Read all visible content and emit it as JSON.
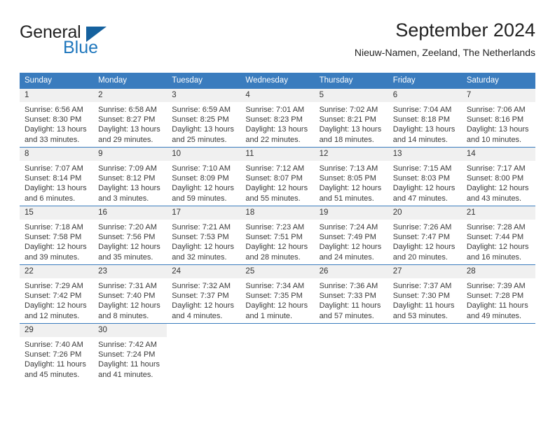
{
  "brand": {
    "name_part1": "General",
    "name_part2": "Blue",
    "triangle_color": "#15619e",
    "blue_color": "#1f77bd"
  },
  "header": {
    "title": "September 2024",
    "subtitle": "Nieuw-Namen, Zeeland, The Netherlands"
  },
  "theme": {
    "header_row_bg": "#3a7cbe",
    "daynum_bg": "#f0f0f0",
    "text": "#3a3a3a"
  },
  "weekday_headers": [
    "Sunday",
    "Monday",
    "Tuesday",
    "Wednesday",
    "Thursday",
    "Friday",
    "Saturday"
  ],
  "weeks": [
    {
      "days": [
        {
          "num": "1",
          "sunrise": "Sunrise: 6:56 AM",
          "sunset": "Sunset: 8:30 PM",
          "daylight1": "Daylight: 13 hours",
          "daylight2": "and 33 minutes."
        },
        {
          "num": "2",
          "sunrise": "Sunrise: 6:58 AM",
          "sunset": "Sunset: 8:27 PM",
          "daylight1": "Daylight: 13 hours",
          "daylight2": "and 29 minutes."
        },
        {
          "num": "3",
          "sunrise": "Sunrise: 6:59 AM",
          "sunset": "Sunset: 8:25 PM",
          "daylight1": "Daylight: 13 hours",
          "daylight2": "and 25 minutes."
        },
        {
          "num": "4",
          "sunrise": "Sunrise: 7:01 AM",
          "sunset": "Sunset: 8:23 PM",
          "daylight1": "Daylight: 13 hours",
          "daylight2": "and 22 minutes."
        },
        {
          "num": "5",
          "sunrise": "Sunrise: 7:02 AM",
          "sunset": "Sunset: 8:21 PM",
          "daylight1": "Daylight: 13 hours",
          "daylight2": "and 18 minutes."
        },
        {
          "num": "6",
          "sunrise": "Sunrise: 7:04 AM",
          "sunset": "Sunset: 8:18 PM",
          "daylight1": "Daylight: 13 hours",
          "daylight2": "and 14 minutes."
        },
        {
          "num": "7",
          "sunrise": "Sunrise: 7:06 AM",
          "sunset": "Sunset: 8:16 PM",
          "daylight1": "Daylight: 13 hours",
          "daylight2": "and 10 minutes."
        }
      ]
    },
    {
      "days": [
        {
          "num": "8",
          "sunrise": "Sunrise: 7:07 AM",
          "sunset": "Sunset: 8:14 PM",
          "daylight1": "Daylight: 13 hours",
          "daylight2": "and 6 minutes."
        },
        {
          "num": "9",
          "sunrise": "Sunrise: 7:09 AM",
          "sunset": "Sunset: 8:12 PM",
          "daylight1": "Daylight: 13 hours",
          "daylight2": "and 3 minutes."
        },
        {
          "num": "10",
          "sunrise": "Sunrise: 7:10 AM",
          "sunset": "Sunset: 8:09 PM",
          "daylight1": "Daylight: 12 hours",
          "daylight2": "and 59 minutes."
        },
        {
          "num": "11",
          "sunrise": "Sunrise: 7:12 AM",
          "sunset": "Sunset: 8:07 PM",
          "daylight1": "Daylight: 12 hours",
          "daylight2": "and 55 minutes."
        },
        {
          "num": "12",
          "sunrise": "Sunrise: 7:13 AM",
          "sunset": "Sunset: 8:05 PM",
          "daylight1": "Daylight: 12 hours",
          "daylight2": "and 51 minutes."
        },
        {
          "num": "13",
          "sunrise": "Sunrise: 7:15 AM",
          "sunset": "Sunset: 8:03 PM",
          "daylight1": "Daylight: 12 hours",
          "daylight2": "and 47 minutes."
        },
        {
          "num": "14",
          "sunrise": "Sunrise: 7:17 AM",
          "sunset": "Sunset: 8:00 PM",
          "daylight1": "Daylight: 12 hours",
          "daylight2": "and 43 minutes."
        }
      ]
    },
    {
      "days": [
        {
          "num": "15",
          "sunrise": "Sunrise: 7:18 AM",
          "sunset": "Sunset: 7:58 PM",
          "daylight1": "Daylight: 12 hours",
          "daylight2": "and 39 minutes."
        },
        {
          "num": "16",
          "sunrise": "Sunrise: 7:20 AM",
          "sunset": "Sunset: 7:56 PM",
          "daylight1": "Daylight: 12 hours",
          "daylight2": "and 35 minutes."
        },
        {
          "num": "17",
          "sunrise": "Sunrise: 7:21 AM",
          "sunset": "Sunset: 7:53 PM",
          "daylight1": "Daylight: 12 hours",
          "daylight2": "and 32 minutes."
        },
        {
          "num": "18",
          "sunrise": "Sunrise: 7:23 AM",
          "sunset": "Sunset: 7:51 PM",
          "daylight1": "Daylight: 12 hours",
          "daylight2": "and 28 minutes."
        },
        {
          "num": "19",
          "sunrise": "Sunrise: 7:24 AM",
          "sunset": "Sunset: 7:49 PM",
          "daylight1": "Daylight: 12 hours",
          "daylight2": "and 24 minutes."
        },
        {
          "num": "20",
          "sunrise": "Sunrise: 7:26 AM",
          "sunset": "Sunset: 7:47 PM",
          "daylight1": "Daylight: 12 hours",
          "daylight2": "and 20 minutes."
        },
        {
          "num": "21",
          "sunrise": "Sunrise: 7:28 AM",
          "sunset": "Sunset: 7:44 PM",
          "daylight1": "Daylight: 12 hours",
          "daylight2": "and 16 minutes."
        }
      ]
    },
    {
      "days": [
        {
          "num": "22",
          "sunrise": "Sunrise: 7:29 AM",
          "sunset": "Sunset: 7:42 PM",
          "daylight1": "Daylight: 12 hours",
          "daylight2": "and 12 minutes."
        },
        {
          "num": "23",
          "sunrise": "Sunrise: 7:31 AM",
          "sunset": "Sunset: 7:40 PM",
          "daylight1": "Daylight: 12 hours",
          "daylight2": "and 8 minutes."
        },
        {
          "num": "24",
          "sunrise": "Sunrise: 7:32 AM",
          "sunset": "Sunset: 7:37 PM",
          "daylight1": "Daylight: 12 hours",
          "daylight2": "and 4 minutes."
        },
        {
          "num": "25",
          "sunrise": "Sunrise: 7:34 AM",
          "sunset": "Sunset: 7:35 PM",
          "daylight1": "Daylight: 12 hours",
          "daylight2": "and 1 minute."
        },
        {
          "num": "26",
          "sunrise": "Sunrise: 7:36 AM",
          "sunset": "Sunset: 7:33 PM",
          "daylight1": "Daylight: 11 hours",
          "daylight2": "and 57 minutes."
        },
        {
          "num": "27",
          "sunrise": "Sunrise: 7:37 AM",
          "sunset": "Sunset: 7:30 PM",
          "daylight1": "Daylight: 11 hours",
          "daylight2": "and 53 minutes."
        },
        {
          "num": "28",
          "sunrise": "Sunrise: 7:39 AM",
          "sunset": "Sunset: 7:28 PM",
          "daylight1": "Daylight: 11 hours",
          "daylight2": "and 49 minutes."
        }
      ]
    },
    {
      "days": [
        {
          "num": "29",
          "sunrise": "Sunrise: 7:40 AM",
          "sunset": "Sunset: 7:26 PM",
          "daylight1": "Daylight: 11 hours",
          "daylight2": "and 45 minutes."
        },
        {
          "num": "30",
          "sunrise": "Sunrise: 7:42 AM",
          "sunset": "Sunset: 7:24 PM",
          "daylight1": "Daylight: 11 hours",
          "daylight2": "and 41 minutes."
        },
        {
          "num": "",
          "sunrise": "",
          "sunset": "",
          "daylight1": "",
          "daylight2": ""
        },
        {
          "num": "",
          "sunrise": "",
          "sunset": "",
          "daylight1": "",
          "daylight2": ""
        },
        {
          "num": "",
          "sunrise": "",
          "sunset": "",
          "daylight1": "",
          "daylight2": ""
        },
        {
          "num": "",
          "sunrise": "",
          "sunset": "",
          "daylight1": "",
          "daylight2": ""
        },
        {
          "num": "",
          "sunrise": "",
          "sunset": "",
          "daylight1": "",
          "daylight2": ""
        }
      ]
    }
  ]
}
